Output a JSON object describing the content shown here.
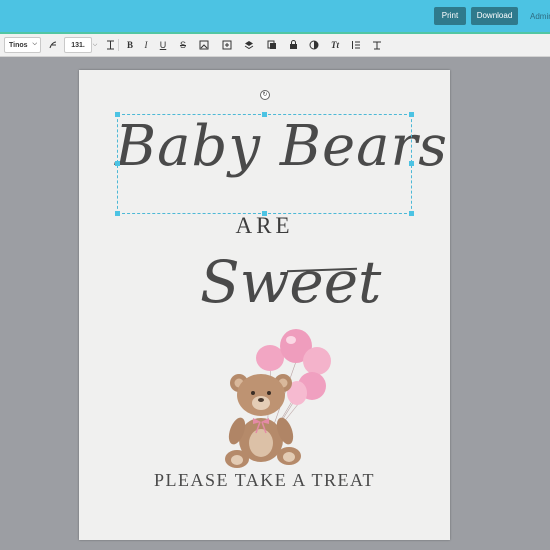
{
  "header": {
    "print_label": "Print",
    "download_label": "Download",
    "admin_label": "Admin"
  },
  "toolbar": {
    "font_name": "Tinos",
    "font_size": "131.",
    "bold": "B",
    "italic": "I",
    "underline": "U",
    "strike": "S",
    "text_style": "Tt",
    "icons": [
      "glyph-icon",
      "text-height-icon",
      "bold-icon",
      "italic-icon",
      "underline-icon",
      "strikethrough-icon",
      "image-icon",
      "add-box-icon",
      "layers-icon",
      "duplicate-icon",
      "lock-icon",
      "effects-icon",
      "text-style-icon",
      "line-spacing-icon",
      "align-icon"
    ]
  },
  "page": {
    "title_script": "Baby Bears",
    "are": "ARE",
    "sweet": "Sweet",
    "tagline": "PLEASE TAKE A TREAT",
    "balloon_color": "#f2a6c3",
    "bear_color": "#b58a6a"
  },
  "colors": {
    "header_bg": "#4cc3e3",
    "button_bg": "#2f7a8c",
    "canvas_bg": "#9c9ea3",
    "page_bg": "#f0f0ef",
    "selection": "#4cc3e3"
  }
}
